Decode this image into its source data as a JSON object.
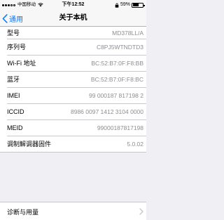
{
  "status_bar": {
    "carrier": "中国移动",
    "time": "下午12:52",
    "battery_percent_text": "59%",
    "battery_level": 0.59
  },
  "nav": {
    "back_label": "通用",
    "title": "关于本机"
  },
  "rows": [
    {
      "label": "型号",
      "value": "MD378LL/A"
    },
    {
      "label": "序列号",
      "value": "C8PJ5WTNDTD3"
    },
    {
      "label": "Wi-Fi 地址",
      "value": "BC:52:B7:0F:F8:BB"
    },
    {
      "label": "蓝牙",
      "value": "BC:52:B7:0F:F8:BC"
    },
    {
      "label": "IMEI",
      "value": "99 000187 817198 2"
    },
    {
      "label": "ICCID",
      "value": "8986 0097 1412 3104 0000"
    },
    {
      "label": "MEID",
      "value": "99000187817198"
    },
    {
      "label": "调制解调器固件",
      "value": "5.0.02"
    }
  ],
  "footer_row": {
    "label": "诊断与用量"
  },
  "colors": {
    "accent": "#007aff",
    "value_text": "#8e8e93",
    "background": "#efeff4"
  }
}
